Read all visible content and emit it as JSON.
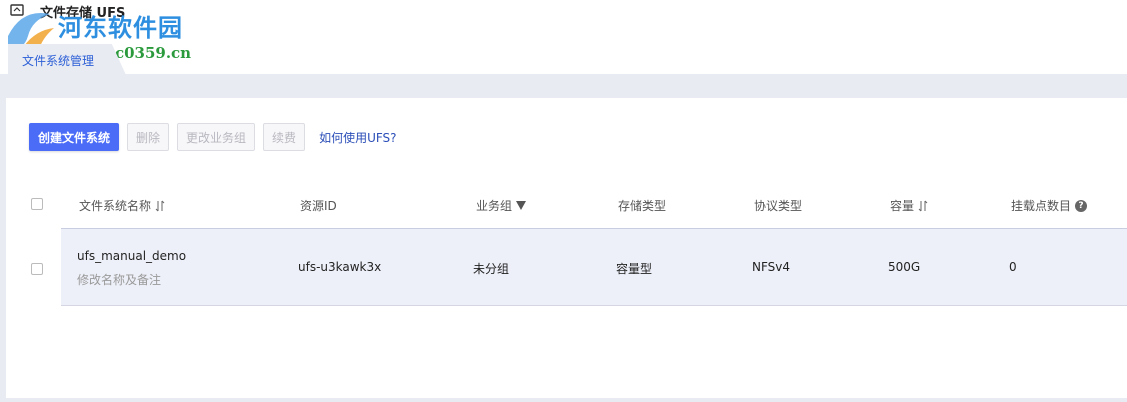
{
  "app": {
    "title": "文件存储 UFS"
  },
  "watermark": {
    "line1": "河东软件园",
    "line2": "www.pc0359.cn"
  },
  "tab": {
    "label": "文件系统管理"
  },
  "toolbar": {
    "create_label": "创建文件系统",
    "delete_label": "删除",
    "change_group_label": "更改业务组",
    "renew_label": "续费",
    "help_link": "如何使用UFS?"
  },
  "table": {
    "columns": {
      "name": "文件系统名称",
      "resource_id": "资源ID",
      "group": "业务组",
      "storage_type": "存储类型",
      "protocol": "协议类型",
      "capacity": "容量",
      "mount_points": "挂载点数目"
    },
    "rows": [
      {
        "name": "ufs_manual_demo",
        "edit_label": "修改名称及备注",
        "resource_id": "ufs-u3kawk3x",
        "group": "未分组",
        "storage_type": "容量型",
        "protocol": "NFSv4",
        "capacity": "500G",
        "mount_points": "0"
      }
    ]
  },
  "icons": {
    "sort": "sort-icon",
    "filter": "filter-icon",
    "help": "help-icon"
  },
  "colors": {
    "primary": "#4a6cf7",
    "link": "#2c4fb8",
    "row_highlight": "#eef0f9",
    "background": "#e9ebf3"
  }
}
